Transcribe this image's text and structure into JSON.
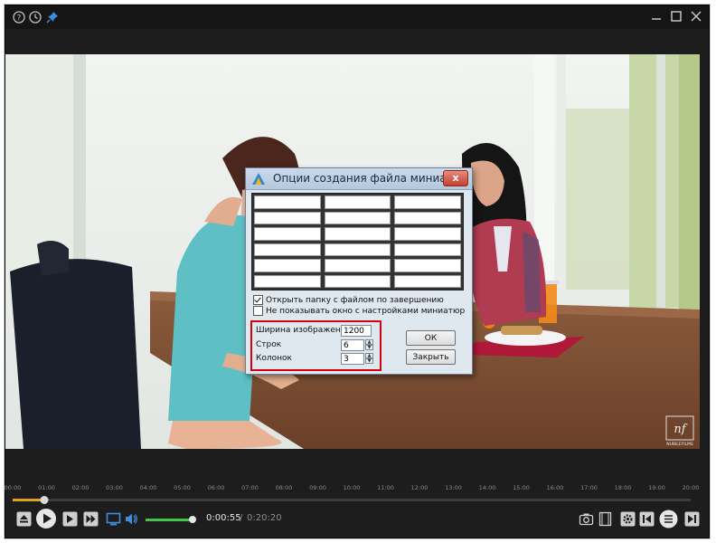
{
  "window": {
    "title_icons": [
      "help-icon",
      "history-icon",
      "pin-icon"
    ],
    "controls": [
      "minimize-icon",
      "maximize-icon",
      "close-icon"
    ]
  },
  "video": {
    "watermark": "nf",
    "watermark_sub": "NUBILEFILMS"
  },
  "dialog": {
    "title": "Опции создания файла миниатюр",
    "close_label": "x",
    "grid": {
      "rows": 6,
      "cols": 3
    },
    "checkboxes": [
      {
        "label": "Открыть папку с файлом по завершению",
        "checked": true
      },
      {
        "label": "Не показывать окно с настройками миниатюр",
        "checked": false
      }
    ],
    "params": {
      "width_label": "Ширина изображения",
      "width_value": "1200",
      "rows_label": "Строк",
      "rows_value": "6",
      "cols_label": "Колонок",
      "cols_value": "3"
    },
    "ok_label": "ОК",
    "close_button_label": "Закрыть"
  },
  "timeline": {
    "ticks": [
      "00:00",
      "01:00",
      "02:00",
      "03:00",
      "04:00",
      "05:00",
      "06:00",
      "07:00",
      "08:00",
      "09:00",
      "10:00",
      "11:00",
      "12:00",
      "13:00",
      "14:00",
      "15:00",
      "16:00",
      "17:00",
      "18:00",
      "19:00",
      "20:00"
    ],
    "progress": 0.046
  },
  "player": {
    "current_time": "0:00:55",
    "separator": "/",
    "total_time": "0:20:20",
    "volume": 1.0,
    "accent_color": "#e0a11b",
    "volume_color": "#41c64a"
  }
}
